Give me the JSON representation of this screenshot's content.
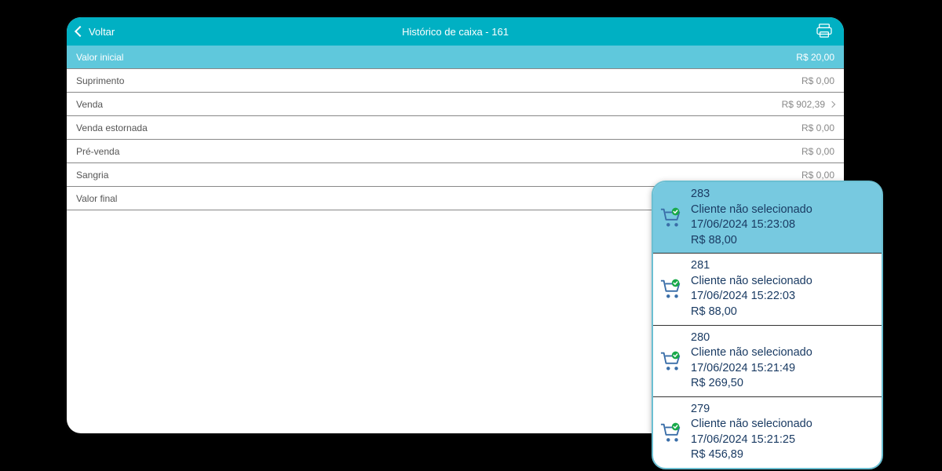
{
  "header": {
    "back_label": "Voltar",
    "title": "Histórico de caixa - 161"
  },
  "rows": [
    {
      "label": "Valor inicial",
      "value": "R$ 20,00",
      "highlight": true,
      "chevron": false
    },
    {
      "label": "Suprimento",
      "value": "R$ 0,00",
      "highlight": false,
      "chevron": false
    },
    {
      "label": "Venda",
      "value": "R$ 902,39",
      "highlight": false,
      "chevron": true
    },
    {
      "label": "Venda estornada",
      "value": "R$ 0,00",
      "highlight": false,
      "chevron": false
    },
    {
      "label": "Pré-venda",
      "value": "R$ 0,00",
      "highlight": false,
      "chevron": false
    },
    {
      "label": "Sangria",
      "value": "R$ 0,00",
      "highlight": false,
      "chevron": false
    },
    {
      "label": "Valor final",
      "value": "",
      "highlight": false,
      "chevron": false
    }
  ],
  "sales": [
    {
      "id": "283",
      "customer": "Cliente não selecionado",
      "datetime": "17/06/2024 15:23:08",
      "amount": "R$ 88,00",
      "selected": true
    },
    {
      "id": "281",
      "customer": "Cliente não selecionado",
      "datetime": "17/06/2024 15:22:03",
      "amount": "R$ 88,00",
      "selected": false
    },
    {
      "id": "280",
      "customer": "Cliente não selecionado",
      "datetime": "17/06/2024 15:21:49",
      "amount": "R$ 269,50",
      "selected": false
    },
    {
      "id": "279",
      "customer": "Cliente não selecionado",
      "datetime": "17/06/2024 15:21:25",
      "amount": "R$ 456,89",
      "selected": false
    }
  ]
}
